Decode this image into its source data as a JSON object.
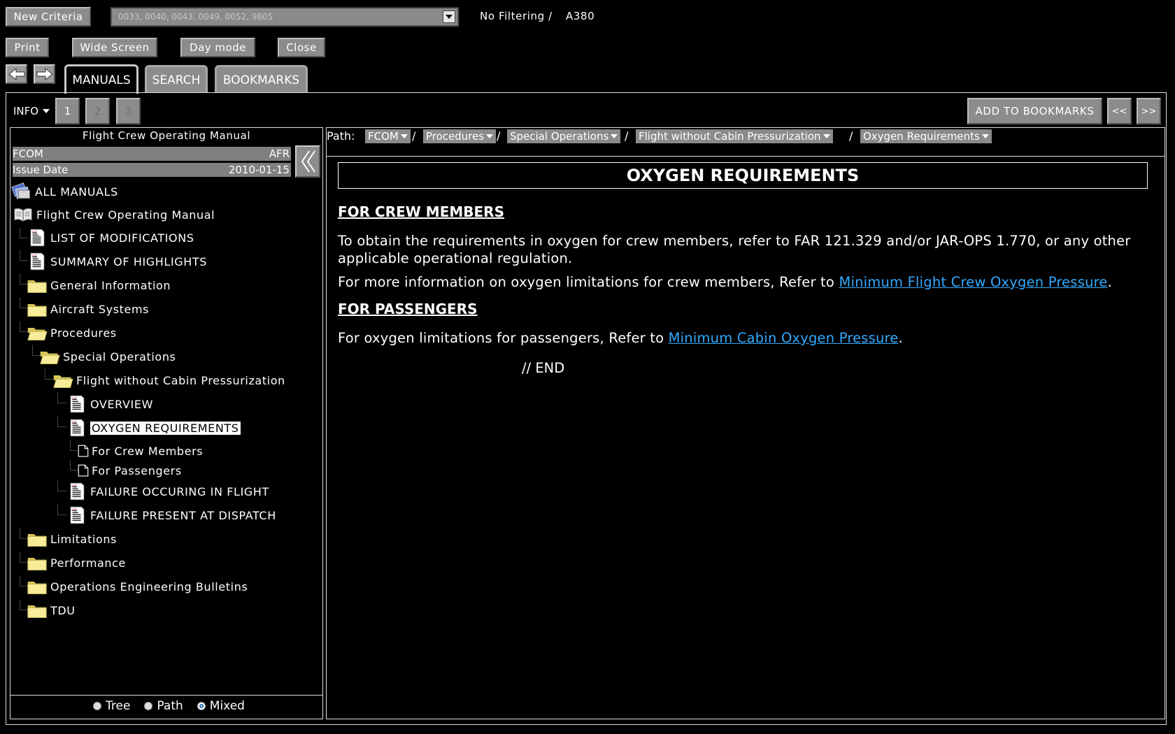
{
  "toolbar": {
    "new_criteria": "New Criteria",
    "criteria_value": "0033, 0040, 0043, 0049, 0052, 9805",
    "filter_status": "No Filtering /",
    "aircraft": "A380",
    "print": "Print",
    "wide_screen": "Wide Screen",
    "day_mode": "Day mode",
    "close": "Close"
  },
  "tabs": [
    {
      "label": "MANUALS",
      "active": true
    },
    {
      "label": "SEARCH",
      "active": false
    },
    {
      "label": "BOOKMARKS",
      "active": false
    }
  ],
  "pagebar": {
    "info": "INFO",
    "pages": [
      "1",
      "2",
      "3"
    ],
    "add_bookmark": "ADD TO BOOKMARKS",
    "prev": "<<",
    "next": ">>"
  },
  "manual_info": {
    "title": "Flight Crew Operating Manual",
    "code": "FCOM",
    "airline": "AFR",
    "issue_label": "Issue Date",
    "issue_date": "2010-01-15"
  },
  "tree": {
    "all_manuals": "ALL MANUALS",
    "root": "Flight Crew Operating Manual",
    "items": [
      "LIST OF MODIFICATIONS",
      "SUMMARY OF HIGHLIGHTS",
      "General Information",
      "Aircraft Systems",
      "Procedures",
      "Special Operations",
      "Flight without Cabin Pressurization",
      "OVERVIEW",
      "OXYGEN REQUIREMENTS",
      "For Crew Members",
      "For Passengers",
      "FAILURE OCCURING IN FLIGHT",
      "FAILURE PRESENT AT DISPATCH",
      "Limitations",
      "Performance",
      "Operations Engineering Bulletins",
      "TDU"
    ]
  },
  "view_mode": {
    "options": [
      "Tree",
      "Path",
      "Mixed"
    ],
    "selected": "Mixed"
  },
  "path": {
    "label": "Path:",
    "crumbs": [
      "FCOM",
      "Procedures",
      "Special Operations",
      "Flight without Cabin Pressurization",
      "Oxygen Requirements"
    ]
  },
  "document": {
    "title": "OXYGEN REQUIREMENTS",
    "section1": "FOR CREW MEMBERS",
    "para1": "To obtain the requirements in oxygen for crew members, refer to FAR 121.329 and/or JAR-OPS 1.770, or any other applicable operational regulation.",
    "para2_pre": "For more information on oxygen limitations for crew members, Refer to ",
    "para2_link": "Minimum Flight Crew Oxygen Pressure",
    "section2": "FOR PASSENGERS",
    "para3_pre": "For oxygen limitations for passengers, Refer to ",
    "para3_link": "Minimum Cabin Oxygen Pressure",
    "end": "// END",
    "period": "."
  },
  "colors": {
    "background": "#000000",
    "button_gray": "#8c8c8c",
    "link": "#33aaff",
    "folder": "#f3e68a"
  }
}
